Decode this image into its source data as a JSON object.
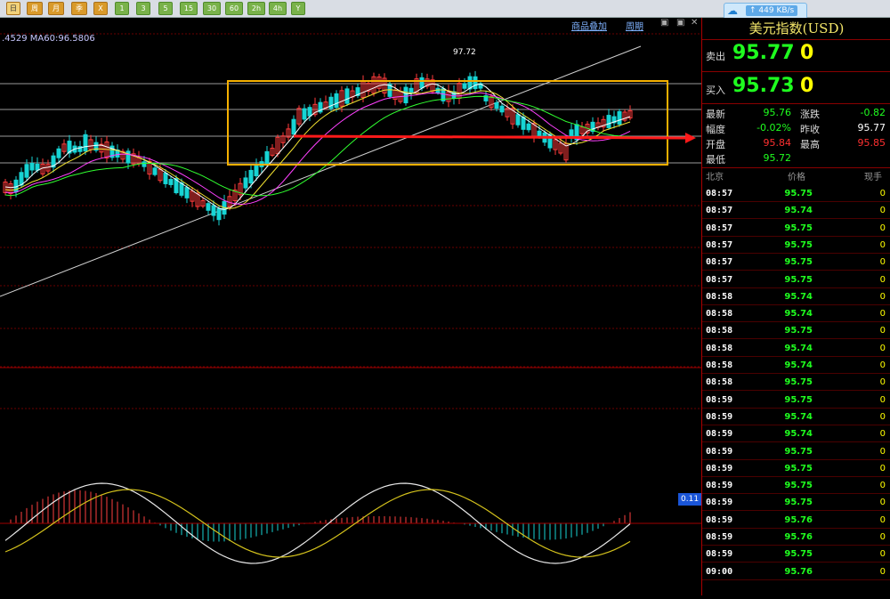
{
  "toolbar": {
    "buttons": [
      "日",
      "周",
      "月",
      "季",
      "X",
      "1",
      "3",
      "5",
      "15",
      "30",
      "60",
      "2h",
      "4h",
      "Y"
    ]
  },
  "network": {
    "speed": "↑ 449 KB/s"
  },
  "chart": {
    "ma_label": ".4529  MA60:96.5806",
    "links": [
      "商品叠加",
      "周期"
    ],
    "high_marker": "97.72",
    "macd_value": "0.11"
  },
  "panel": {
    "title": "美元指数(USD)",
    "sell_label": "卖出",
    "sell_price": "95.77",
    "sell_qty": "0",
    "buy_label": "买入",
    "buy_price": "95.73",
    "buy_qty": "0",
    "stats": [
      {
        "label": "最新",
        "value": "95.76",
        "color": "#1fff1f",
        "label2": "涨跌",
        "value2": "-0.82",
        "color2": "#1fff1f"
      },
      {
        "label": "幅度",
        "value": "-0.02%",
        "color": "#1fff1f",
        "label2": "昨收",
        "value2": "95.77",
        "color2": "#ffffff"
      },
      {
        "label": "开盘",
        "value": "95.84",
        "color": "#ff3030",
        "label2": "最高",
        "value2": "95.85",
        "color2": "#ff3030"
      },
      {
        "label": "最低",
        "value": "95.72",
        "color": "#1fff1f",
        "label2": "",
        "value2": "",
        "color2": "#fff"
      }
    ],
    "trades_header": {
      "time": "北京",
      "price": "价格",
      "volume": "现手"
    },
    "trades": [
      {
        "time": "08:57",
        "price": "95.75",
        "volume": "0"
      },
      {
        "time": "08:57",
        "price": "95.74",
        "volume": "0"
      },
      {
        "time": "08:57",
        "price": "95.75",
        "volume": "0"
      },
      {
        "time": "08:57",
        "price": "95.75",
        "volume": "0"
      },
      {
        "time": "08:57",
        "price": "95.75",
        "volume": "0"
      },
      {
        "time": "08:57",
        "price": "95.75",
        "volume": "0"
      },
      {
        "time": "08:58",
        "price": "95.74",
        "volume": "0"
      },
      {
        "time": "08:58",
        "price": "95.74",
        "volume": "0"
      },
      {
        "time": "08:58",
        "price": "95.75",
        "volume": "0"
      },
      {
        "time": "08:58",
        "price": "95.74",
        "volume": "0"
      },
      {
        "time": "08:58",
        "price": "95.74",
        "volume": "0"
      },
      {
        "time": "08:58",
        "price": "95.75",
        "volume": "0"
      },
      {
        "time": "08:59",
        "price": "95.75",
        "volume": "0"
      },
      {
        "time": "08:59",
        "price": "95.74",
        "volume": "0"
      },
      {
        "time": "08:59",
        "price": "95.74",
        "volume": "0"
      },
      {
        "time": "08:59",
        "price": "95.75",
        "volume": "0"
      },
      {
        "time": "08:59",
        "price": "95.75",
        "volume": "0"
      },
      {
        "time": "08:59",
        "price": "95.75",
        "volume": "0"
      },
      {
        "time": "08:59",
        "price": "95.75",
        "volume": "0"
      },
      {
        "time": "08:59",
        "price": "95.76",
        "volume": "0"
      },
      {
        "time": "08:59",
        "price": "95.76",
        "volume": "0"
      },
      {
        "time": "08:59",
        "price": "95.75",
        "volume": "0"
      },
      {
        "time": "09:00",
        "price": "95.76",
        "volume": "0"
      }
    ]
  }
}
